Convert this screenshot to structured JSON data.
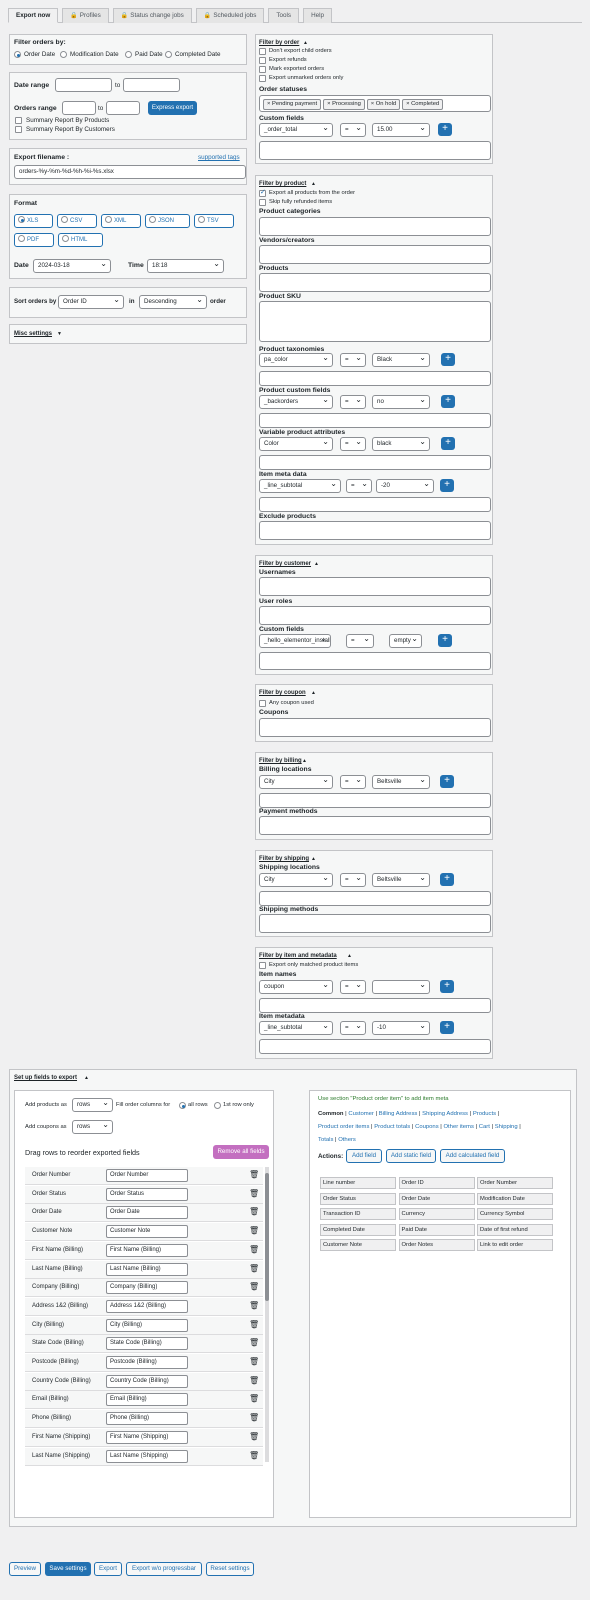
{
  "tabs": [
    "Export now",
    "Profiles",
    "Status change jobs",
    "Scheduled jobs",
    "Tools",
    "Help"
  ],
  "filter": {
    "title": "Filter orders by:",
    "options": [
      "Order Date",
      "Modification Date",
      "Paid Date",
      "Completed Date"
    ],
    "selected": "Order Date"
  },
  "date_range": {
    "label": "Date range",
    "to": "to"
  },
  "orders_range": {
    "label": "Orders range",
    "to": "to",
    "express_btn": "Express export"
  },
  "summary": [
    "Summary Report By Products",
    "Summary Report By Customers"
  ],
  "export_filename": {
    "label": "Export filename :",
    "supported": "supported tags",
    "value": "orders-%y-%m-%d-%h-%i-%s.xlsx"
  },
  "format": {
    "label": "Format",
    "options": [
      "XLS",
      "CSV",
      "XML",
      "JSON",
      "TSV",
      "PDF",
      "HTML"
    ],
    "selected": "XLS"
  },
  "date": {
    "label": "Date",
    "value": "2024-03-18",
    "time_label": "Time",
    "time_value": "18:18"
  },
  "sort": {
    "label": "Sort orders by",
    "field": "Order ID",
    "in": "in",
    "direction": "Descending",
    "suffix": "order"
  },
  "misc": "Misc settings",
  "order_filter": {
    "title": "Filter by order",
    "checks": [
      "Don't export child orders",
      "Export refunds",
      "Mark exported orders",
      "Export unmarked orders only"
    ],
    "statuses_label": "Order statuses",
    "statuses": [
      "× Pending payment",
      "× Processing",
      "× On hold",
      "× Completed"
    ],
    "custom_label": "Custom fields",
    "custom_field": "_order_total",
    "op": "=",
    "value": "15.00"
  },
  "product_filter": {
    "title": "Filter by product",
    "check1": "Export all products from the order",
    "check2": "Skip fully refunded items",
    "categories": "Product categories",
    "vendors": "Vendors/creators",
    "products": "Products",
    "sku": "Product SKU",
    "taxonomies": "Product taxonomies",
    "tax_field": "pa_color",
    "tax_op": "=",
    "tax_val": "Black",
    "pcf": "Product custom fields",
    "pcf_field": "_backorders",
    "pcf_op": "=",
    "pcf_val": "no",
    "vpa": "Variable product attributes",
    "vpa_field": "Color",
    "vpa_op": "=",
    "vpa_val": "black",
    "imd": "Item meta data",
    "imd_field": "_line_subtotal",
    "imd_op": "=",
    "imd_val": "-20",
    "exclude": "Exclude products"
  },
  "customer_filter": {
    "title": "Filter by customer",
    "usernames": "Usernames",
    "roles": "User roles",
    "custom": "Custom fields",
    "cf_field": "_hello_elementor_install",
    "cf_op": "=",
    "cf_val": "empty"
  },
  "coupon_filter": {
    "title": "Filter by coupon",
    "check": "Any coupon used",
    "coupons": "Coupons"
  },
  "billing_filter": {
    "title": "Filter by billing",
    "locations": "Billing locations",
    "field": "City",
    "op": "=",
    "val": "Beltsville",
    "payment": "Payment methods"
  },
  "shipping_filter": {
    "title": "Filter by shipping",
    "locations": "Shipping locations",
    "field": "City",
    "op": "=",
    "val": "Beltsville",
    "methods": "Shipping methods"
  },
  "item_filter": {
    "title": "Filter by item and metadata",
    "check": "Export only matched product items",
    "names": "Item names",
    "name_field": "coupon",
    "name_op": "=",
    "metadata": "Item metadata",
    "meta_field": "_line_subtotal",
    "meta_op": "=",
    "meta_val": "-10"
  },
  "setup": {
    "title": "Set up fields to export",
    "add_products": "Add products as",
    "add_products_val": "rows",
    "fill_label": "Fill order columns for",
    "fill_all": "all rows",
    "fill_first": "1st row only",
    "add_coupons": "Add coupons as",
    "add_coupons_val": "rows",
    "drag_label": "Drag rows to reorder exported fields",
    "remove_all": "Remove all fields"
  },
  "fields": [
    [
      "Order Number",
      "Order Number"
    ],
    [
      "Order Status",
      "Order Status"
    ],
    [
      "Order Date",
      "Order Date"
    ],
    [
      "Customer Note",
      "Customer Note"
    ],
    [
      "First Name (Billing)",
      "First Name (Billing)"
    ],
    [
      "Last Name (Billing)",
      "Last Name (Billing)"
    ],
    [
      "Company (Billing)",
      "Company (Billing)"
    ],
    [
      "Address 1&2 (Billing)",
      "Address 1&2 (Billing)"
    ],
    [
      "City (Billing)",
      "City (Billing)"
    ],
    [
      "State Code (Billing)",
      "State Code (Billing)"
    ],
    [
      "Postcode (Billing)",
      "Postcode (Billing)"
    ],
    [
      "Country Code (Billing)",
      "Country Code (Billing)"
    ],
    [
      "Email (Billing)",
      "Email (Billing)"
    ],
    [
      "Phone (Billing)",
      "Phone (Billing)"
    ],
    [
      "First Name (Shipping)",
      "First Name (Shipping)"
    ],
    [
      "Last Name (Shipping)",
      "Last Name (Shipping)"
    ]
  ],
  "right_panel": {
    "hint": "Use section \"Product order item\" to add item meta",
    "links": [
      "Common",
      "Customer",
      "Billing Address",
      "Shipping Address",
      "Products",
      "Product order items",
      "Product totals",
      "Coupons",
      "Other items",
      "Cart",
      "Shipping",
      "Totals",
      "Others"
    ],
    "actions": "Actions:",
    "add_field": "Add field",
    "add_static": "Add static field",
    "add_calc": "Add calculated field",
    "cells": [
      "Line number",
      "Order ID",
      "Order Number",
      "Order Status",
      "Order Date",
      "Modification Date",
      "Transaction ID",
      "Currency",
      "Currency Symbol",
      "Completed Date",
      "Paid Date",
      "Date of first refund",
      "Customer Note",
      "Order Notes",
      "Link to edit order"
    ]
  },
  "bottom": [
    "Preview",
    "Save settings",
    "Export",
    "Export w/o progressbar",
    "Reset settings"
  ]
}
